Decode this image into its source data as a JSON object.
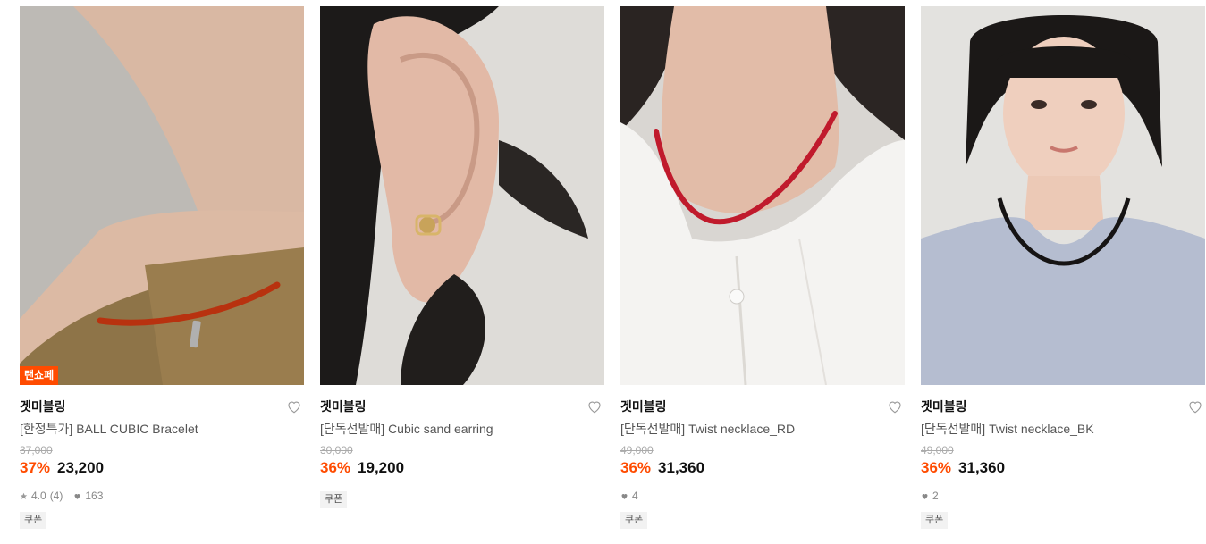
{
  "products": [
    {
      "brand": "겟미블링",
      "name": "[한정특가] BALL CUBIC Bracelet",
      "original_price": "37,000",
      "discount": "37%",
      "price": "23,200",
      "badge": "랜쇼페",
      "rating": "4.0",
      "review_count": "(4)",
      "likes": "163",
      "coupon": "쿠폰"
    },
    {
      "brand": "겟미블링",
      "name": "[단독선발매] Cubic sand earring",
      "original_price": "30,000",
      "discount": "36%",
      "price": "19,200",
      "coupon": "쿠폰"
    },
    {
      "brand": "겟미블링",
      "name": "[단독선발매] Twist necklace_RD",
      "original_price": "49,000",
      "discount": "36%",
      "price": "31,360",
      "likes": "4",
      "coupon": "쿠폰"
    },
    {
      "brand": "겟미블링",
      "name": "[단독선발매] Twist necklace_BK",
      "original_price": "49,000",
      "discount": "36%",
      "price": "31,360",
      "likes": "2",
      "coupon": "쿠폰"
    }
  ],
  "colors": {
    "accent": "#ff4b00",
    "badge_bg": "#ff4b00",
    "coupon_bg": "#f2f2f2"
  }
}
